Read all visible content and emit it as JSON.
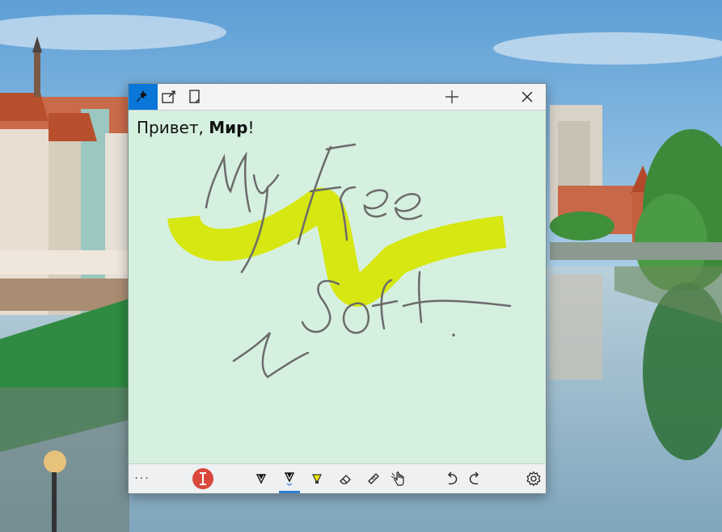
{
  "note": {
    "greeting": "Привет, ",
    "bold_word": "Мир",
    "punct": "!"
  },
  "handwriting": [
    "My",
    "Free",
    "Soft"
  ],
  "toolbar": {
    "more_label": "···",
    "active_pen": "pen-2"
  },
  "colors": {
    "accent": "#0a76d8",
    "note_background": "#d6f0e0",
    "highlighter": "#d6e600",
    "ink": "#6b6b6b",
    "text_tool": "#d9483b"
  },
  "icons": [
    "pin-icon",
    "popout-icon",
    "page-icon",
    "plus-icon",
    "close-icon",
    "more-icon",
    "text-cursor-icon",
    "pen-icon",
    "highlighter-icon",
    "eraser-icon",
    "ruler-icon",
    "touch-icon",
    "undo-icon",
    "redo-icon",
    "gear-icon"
  ]
}
